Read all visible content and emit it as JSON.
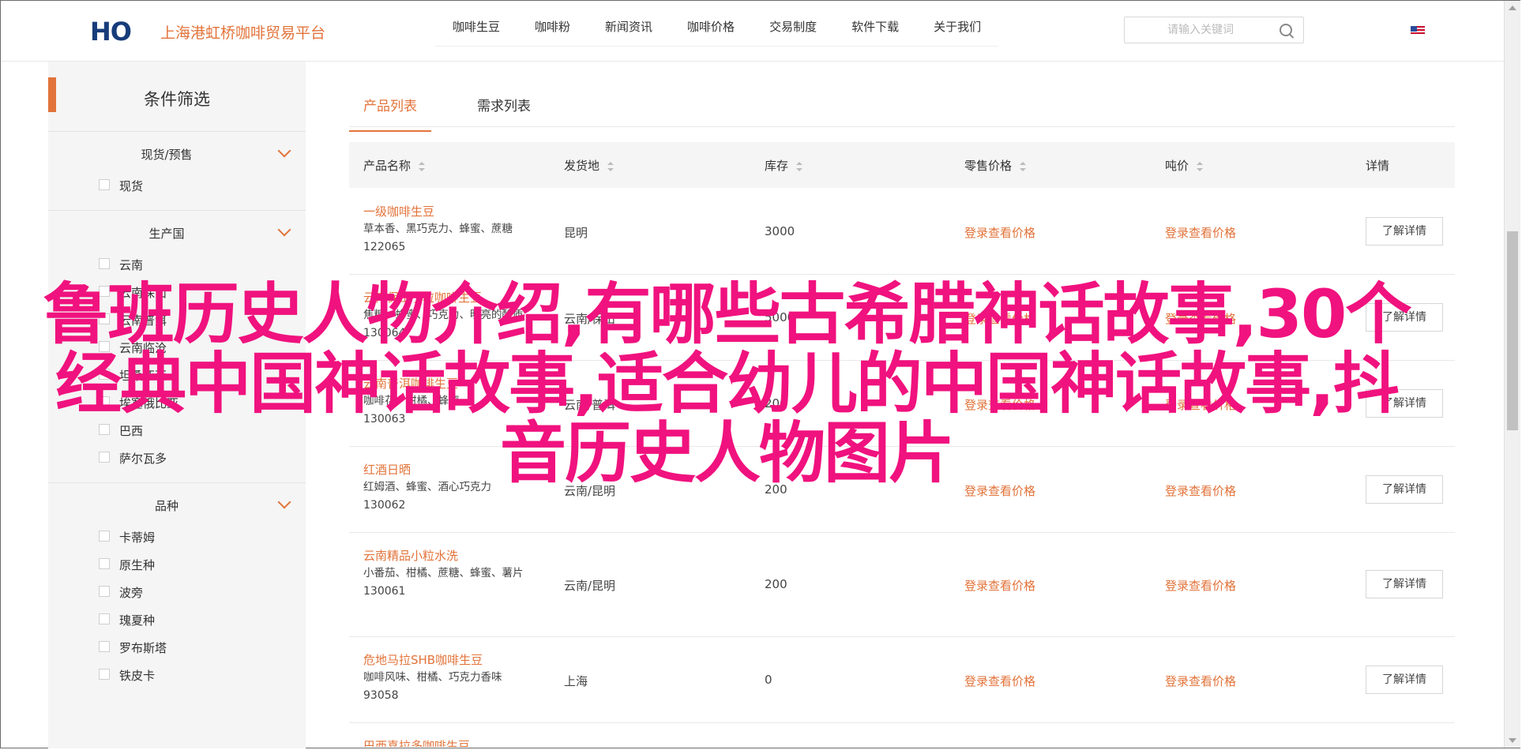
{
  "header": {
    "logo_text": "HO",
    "site_name": "上海港虹桥咖啡贸易平台",
    "nav": [
      "咖啡生豆",
      "咖啡粉",
      "新闻资讯",
      "咖啡价格",
      "交易制度",
      "软件下载",
      "关于我们"
    ],
    "search_placeholder": "请输入关键词",
    "language_flag": "us-flag-icon"
  },
  "sidebar": {
    "title": "条件筛选",
    "groups": [
      {
        "label": "现货/预售",
        "options": [
          "现货"
        ]
      },
      {
        "label": "生产国",
        "options": [
          "云南",
          "云南保山",
          "云南普洱",
          "云南临沧",
          "坦桑亚亚",
          "埃塞俄比亚",
          "巴西",
          "萨尔瓦多"
        ]
      },
      {
        "label": "品种",
        "options": [
          "卡蒂姆",
          "原生种",
          "波旁",
          "瑰夏种",
          "罗布斯塔",
          "铁皮卡"
        ]
      }
    ]
  },
  "tabs": [
    "产品列表",
    "需求列表"
  ],
  "table": {
    "headers": [
      "产品名称",
      "发货地",
      "库存",
      "零售价格",
      "吨价",
      "详情"
    ],
    "rows": [
      {
        "name": "一级咖啡生豆",
        "desc": "草本香、黑巧克力、蜂蜜、蔗糖",
        "code": "122065",
        "origin": "昆明",
        "stock": "3000",
        "retail": "登录查看价格",
        "ton": "登录查看价格",
        "btn": "了解详情"
      },
      {
        "name": "云南保山小粒咖啡生豆",
        "desc": "焦糖、蜂蜜、巧克力、明亮的酸质",
        "code": "130064",
        "origin": "云南/保山",
        "stock": "5000",
        "retail": "登录查看价格",
        "ton": "登录查看价格",
        "btn": "了解详情"
      },
      {
        "name": "云南普洱咖啡生豆",
        "desc": "咖啡花、柑橘、蜂蜜",
        "code": "130063",
        "origin": "云南/普洱",
        "stock": "200",
        "retail": "登录查看价格",
        "ton": "登录查看价格",
        "btn": "了解详情"
      },
      {
        "name": "红酒日晒",
        "desc": "红姆酒、蜂蜜、酒心巧克力",
        "code": "130062",
        "origin": "云南/昆明",
        "stock": "200",
        "retail": "登录查看价格",
        "ton": "登录查看价格",
        "btn": "了解详情"
      },
      {
        "name": "云南精品小粒水洗",
        "desc": "小番茄、柑橘、蔗糖、蜂蜜、薯片",
        "code": "130061",
        "origin": "云南/昆明",
        "stock": "200",
        "retail": "登录查看价格",
        "ton": "登录查看价格",
        "btn": "了解详情"
      },
      {
        "name": "危地马拉SHB咖啡生豆",
        "desc": "咖啡风味、柑橘、巧克力香味",
        "code": "93058",
        "origin": "上海",
        "stock": "0",
        "retail": "登录查看价格",
        "ton": "登录查看价格",
        "btn": "了解详情"
      },
      {
        "name": "巴西喜拉多咖啡生豆",
        "desc": "",
        "code": "",
        "origin": "",
        "stock": "",
        "retail": "",
        "ton": "",
        "btn": ""
      }
    ]
  },
  "overlay_text": "鲁班历史人物介绍,有哪些古希腊神话故事,30个经典中国神话故事,适合幼儿的中国神话故事,抖音历史人物图片"
}
